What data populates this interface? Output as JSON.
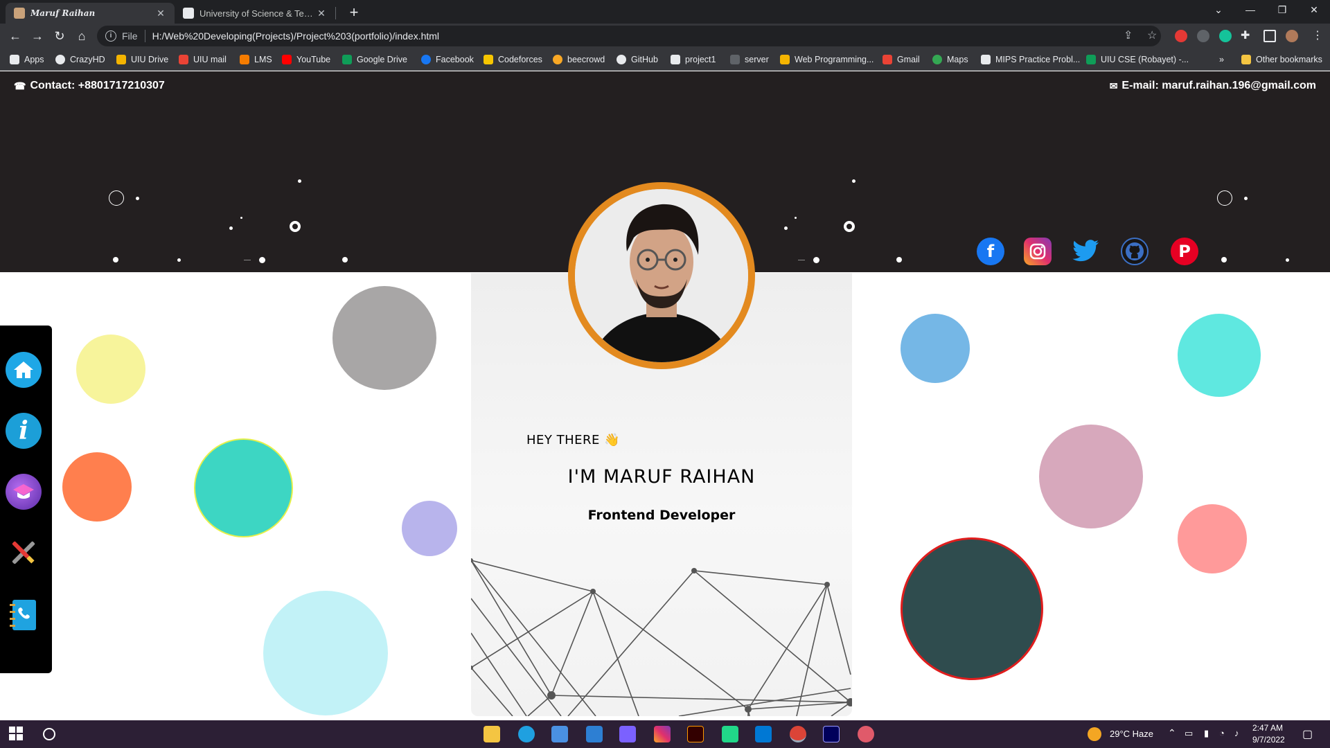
{
  "browser": {
    "tabs": [
      {
        "title": "Maruf Raihan",
        "active": true
      },
      {
        "title": "University of Science & Technolo",
        "active": false
      }
    ],
    "address": {
      "scheme": "File",
      "url": "H:/Web%20Developing(Projects)/Project%203(portfolio)/index.html"
    },
    "bookmarks": [
      "Apps",
      "CrazyHD",
      "UIU Drive",
      "UIU mail",
      "LMS",
      "YouTube",
      "Google Drive",
      "Facebook",
      "Codeforces",
      "beecrowd",
      "GitHub",
      "project1",
      "server",
      "Web Programming...",
      "Gmail",
      "Maps",
      "MIPS Practice Probl...",
      "UIU CSE (Robayet) -..."
    ],
    "other_bookmarks": "Other bookmarks",
    "overflow": "»"
  },
  "page": {
    "contact": "Contact: +8801717210307",
    "email": "E-mail: maruf.raihan.196@gmail.com",
    "greeting": "HEY THERE",
    "greeting_emoji": "👋",
    "name": "I'M MARUF RAIHAN",
    "role": "Frontend Developer",
    "social": [
      "facebook",
      "instagram",
      "twitter",
      "github",
      "pinterest"
    ],
    "nav_icons": [
      "home-icon",
      "info-icon",
      "graduation-icon",
      "tools-icon",
      "contact-book-icon"
    ],
    "colors": {
      "header": "#231f20",
      "avatar_ring": "#e38a1f",
      "sidebar": "#000000"
    }
  },
  "taskbar": {
    "weather": "29°C  Haze",
    "time": "2:47 AM",
    "date": "9/7/2022"
  }
}
